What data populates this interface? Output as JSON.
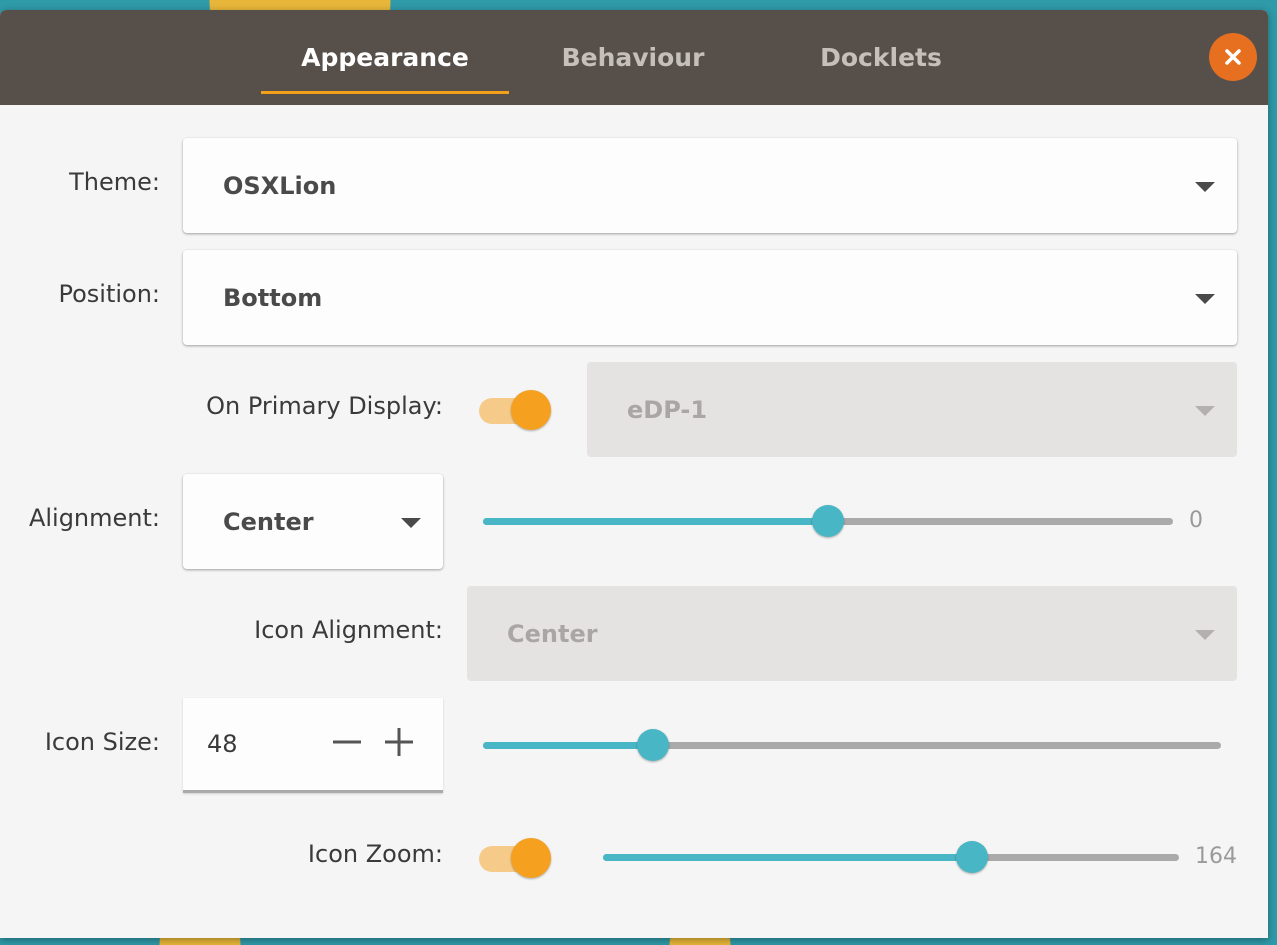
{
  "tabs": [
    {
      "label": "Appearance",
      "active": true
    },
    {
      "label": "Behaviour",
      "active": false
    },
    {
      "label": "Docklets",
      "active": false
    }
  ],
  "colors": {
    "accent": "#f2a01a",
    "slider": "#49b6c5",
    "close_button": "#e67020",
    "header": "#574f4a"
  },
  "theme": {
    "label": "Theme:",
    "value": "OSXLion"
  },
  "position": {
    "label": "Position:",
    "value": "Bottom"
  },
  "primary_display": {
    "label": "On Primary Display:",
    "enabled": true,
    "monitor_value": "eDP-1"
  },
  "alignment": {
    "label": "Alignment:",
    "value": "Center",
    "offset_value": "0",
    "offset_fraction": 0.5
  },
  "icon_alignment": {
    "label": "Icon Alignment:",
    "value": "Center"
  },
  "icon_size": {
    "label": "Icon Size:",
    "value": "48",
    "minus_icon": "minus-icon",
    "plus_icon": "plus-icon",
    "slider_fraction": 0.23
  },
  "icon_zoom": {
    "label": "Icon Zoom:",
    "enabled": true,
    "value": "164",
    "slider_fraction": 0.64
  },
  "close_icon": "close-icon"
}
